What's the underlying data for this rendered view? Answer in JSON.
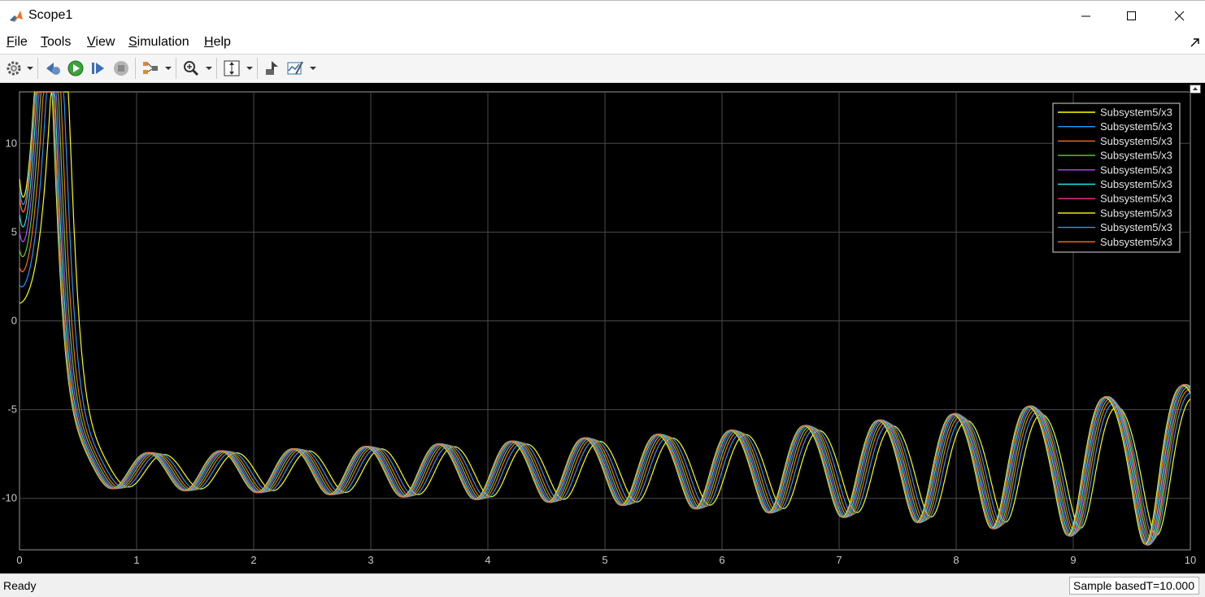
{
  "window": {
    "title": "Scope1"
  },
  "menu": {
    "items": [
      {
        "label": "File",
        "mnemonic": "F",
        "rest": "ile"
      },
      {
        "label": "Tools",
        "mnemonic": "T",
        "rest": "ools"
      },
      {
        "label": "View",
        "mnemonic": "V",
        "rest": "iew"
      },
      {
        "label": "Simulation",
        "mnemonic": "S",
        "rest": "imulation"
      },
      {
        "label": "Help",
        "mnemonic": "H",
        "rest": "elp"
      }
    ]
  },
  "toolbar": {
    "icons": [
      "gear-icon",
      "step-back-icon",
      "run-icon",
      "step-forward-icon",
      "stop-icon",
      "signal-selector-icon",
      "zoom-icon",
      "autoscale-icon",
      "highlight-simulink-block-icon",
      "style-icon"
    ]
  },
  "status": {
    "text": "Ready",
    "mode": "Sample based",
    "time": "T=10.000"
  },
  "colors": {
    "plot_background": "#000000",
    "grid": "#4a4a4a",
    "axis_text": "#c8c8c8",
    "series": [
      "#ffff00",
      "#1e9bff",
      "#ff6a1e",
      "#5fd21e",
      "#b44bff",
      "#1ee6e6",
      "#ff2d9b",
      "#ffff00",
      "#1e9bff",
      "#ff6a1e"
    ]
  },
  "chart_data": {
    "type": "line",
    "title": "",
    "xlabel": "",
    "ylabel": "",
    "xlim": [
      0,
      10
    ],
    "ylim": [
      -12.9,
      12.9
    ],
    "xticks": [
      0,
      1,
      2,
      3,
      4,
      5,
      6,
      7,
      8,
      9,
      10
    ],
    "yticks": [
      -10,
      -5,
      0,
      5,
      10
    ],
    "grid": true,
    "legend_position": "top-right",
    "series": [
      {
        "name": "Subsystem5/x3",
        "x0": 1.0
      },
      {
        "name": "Subsystem5/x3",
        "x0": 2.0
      },
      {
        "name": "Subsystem5/x3",
        "x0": 3.0
      },
      {
        "name": "Subsystem5/x3",
        "x0": 4.0
      },
      {
        "name": "Subsystem5/x3",
        "x0": 5.0
      },
      {
        "name": "Subsystem5/x3",
        "x0": 6.0
      },
      {
        "name": "Subsystem5/x3",
        "x0": 7.0
      },
      {
        "name": "Subsystem5/x3",
        "x0": 8.0
      },
      {
        "name": "Subsystem5/x3",
        "x0": 7.5
      },
      {
        "name": "Subsystem5/x3",
        "x0": 7.0
      }
    ]
  }
}
